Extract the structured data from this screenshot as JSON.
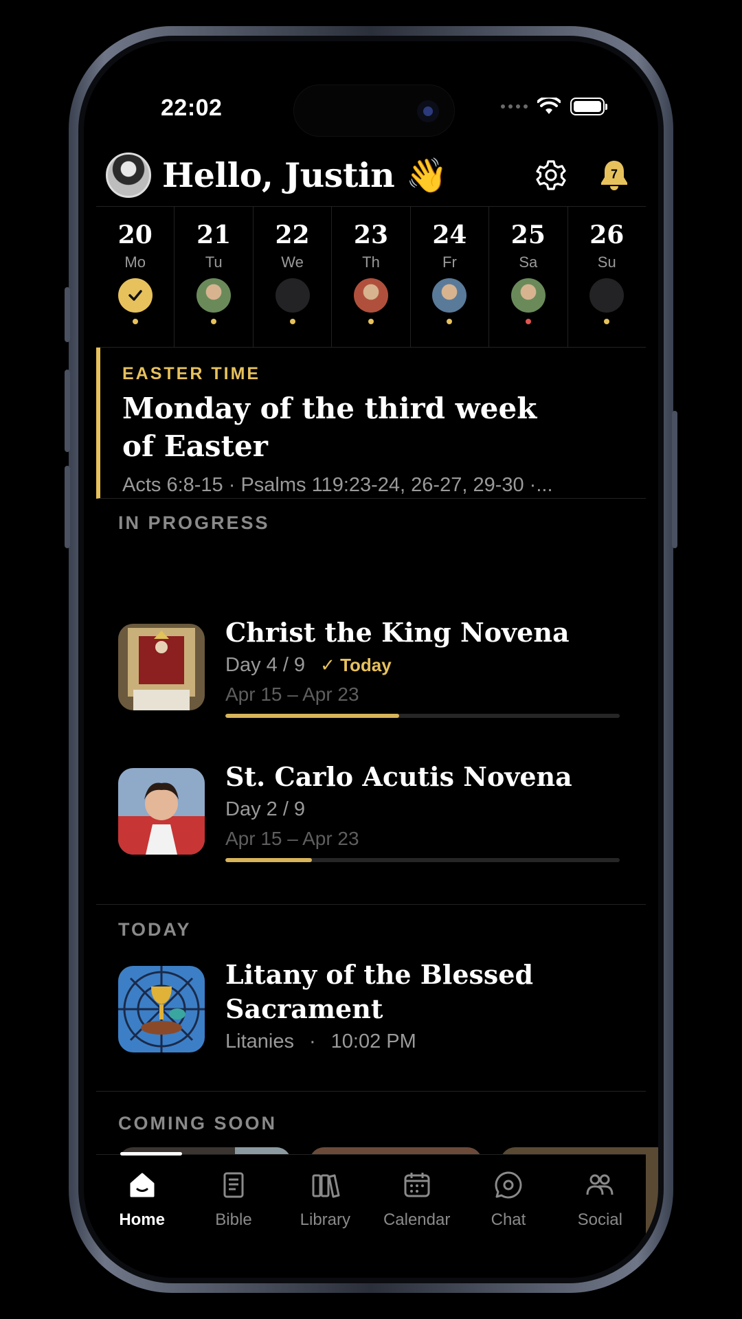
{
  "status_bar": {
    "time": "22:02"
  },
  "header": {
    "greeting": "Hello, Justin 👋",
    "notification_count": "7"
  },
  "week": [
    {
      "num": "20",
      "name": "Mo",
      "state": "done",
      "dot": "gold"
    },
    {
      "num": "21",
      "name": "Tu",
      "state": "saint",
      "dot": "gold"
    },
    {
      "num": "22",
      "name": "We",
      "state": "empty",
      "dot": "gold"
    },
    {
      "num": "23",
      "name": "Th",
      "state": "saint",
      "dot": "gold"
    },
    {
      "num": "24",
      "name": "Fr",
      "state": "saint",
      "dot": "gold"
    },
    {
      "num": "25",
      "name": "Sa",
      "state": "saint",
      "dot": "red"
    },
    {
      "num": "26",
      "name": "Su",
      "state": "empty",
      "dot": "gold"
    }
  ],
  "season": {
    "tag": "EASTER TIME",
    "title": "Monday of the third week of Easter",
    "readings": "Acts 6:8-15  ·  Psalms 119:23-24, 26-27, 29-30  ·..."
  },
  "in_progress": {
    "title": "IN PROGRESS",
    "items": [
      {
        "title": "Christ the King Novena",
        "day": "Day 4 / 9",
        "badge": "✓ Today",
        "dates": "Apr 15 – Apr 23",
        "progress": 0.44
      },
      {
        "title": "St. Carlo Acutis Novena",
        "day": "Day 2 / 9",
        "dates": "Apr 15 – Apr 23",
        "progress": 0.22
      }
    ]
  },
  "today": {
    "title": "TODAY",
    "item": {
      "title": "Litany of the Blessed Sacrament",
      "category": "Litanies",
      "time": "10:02 PM"
    }
  },
  "coming_soon": {
    "title": "COMING SOON"
  },
  "tabs": [
    {
      "label": "Home",
      "icon": "home-icon",
      "active": true
    },
    {
      "label": "Bible",
      "icon": "bible-icon"
    },
    {
      "label": "Library",
      "icon": "library-icon"
    },
    {
      "label": "Calendar",
      "icon": "calendar-icon"
    },
    {
      "label": "Chat",
      "icon": "chat-icon"
    },
    {
      "label": "Social",
      "icon": "social-icon"
    }
  ],
  "colors": {
    "accent": "#e7c15c",
    "background": "#000000",
    "muted": "#9a9a9a"
  }
}
